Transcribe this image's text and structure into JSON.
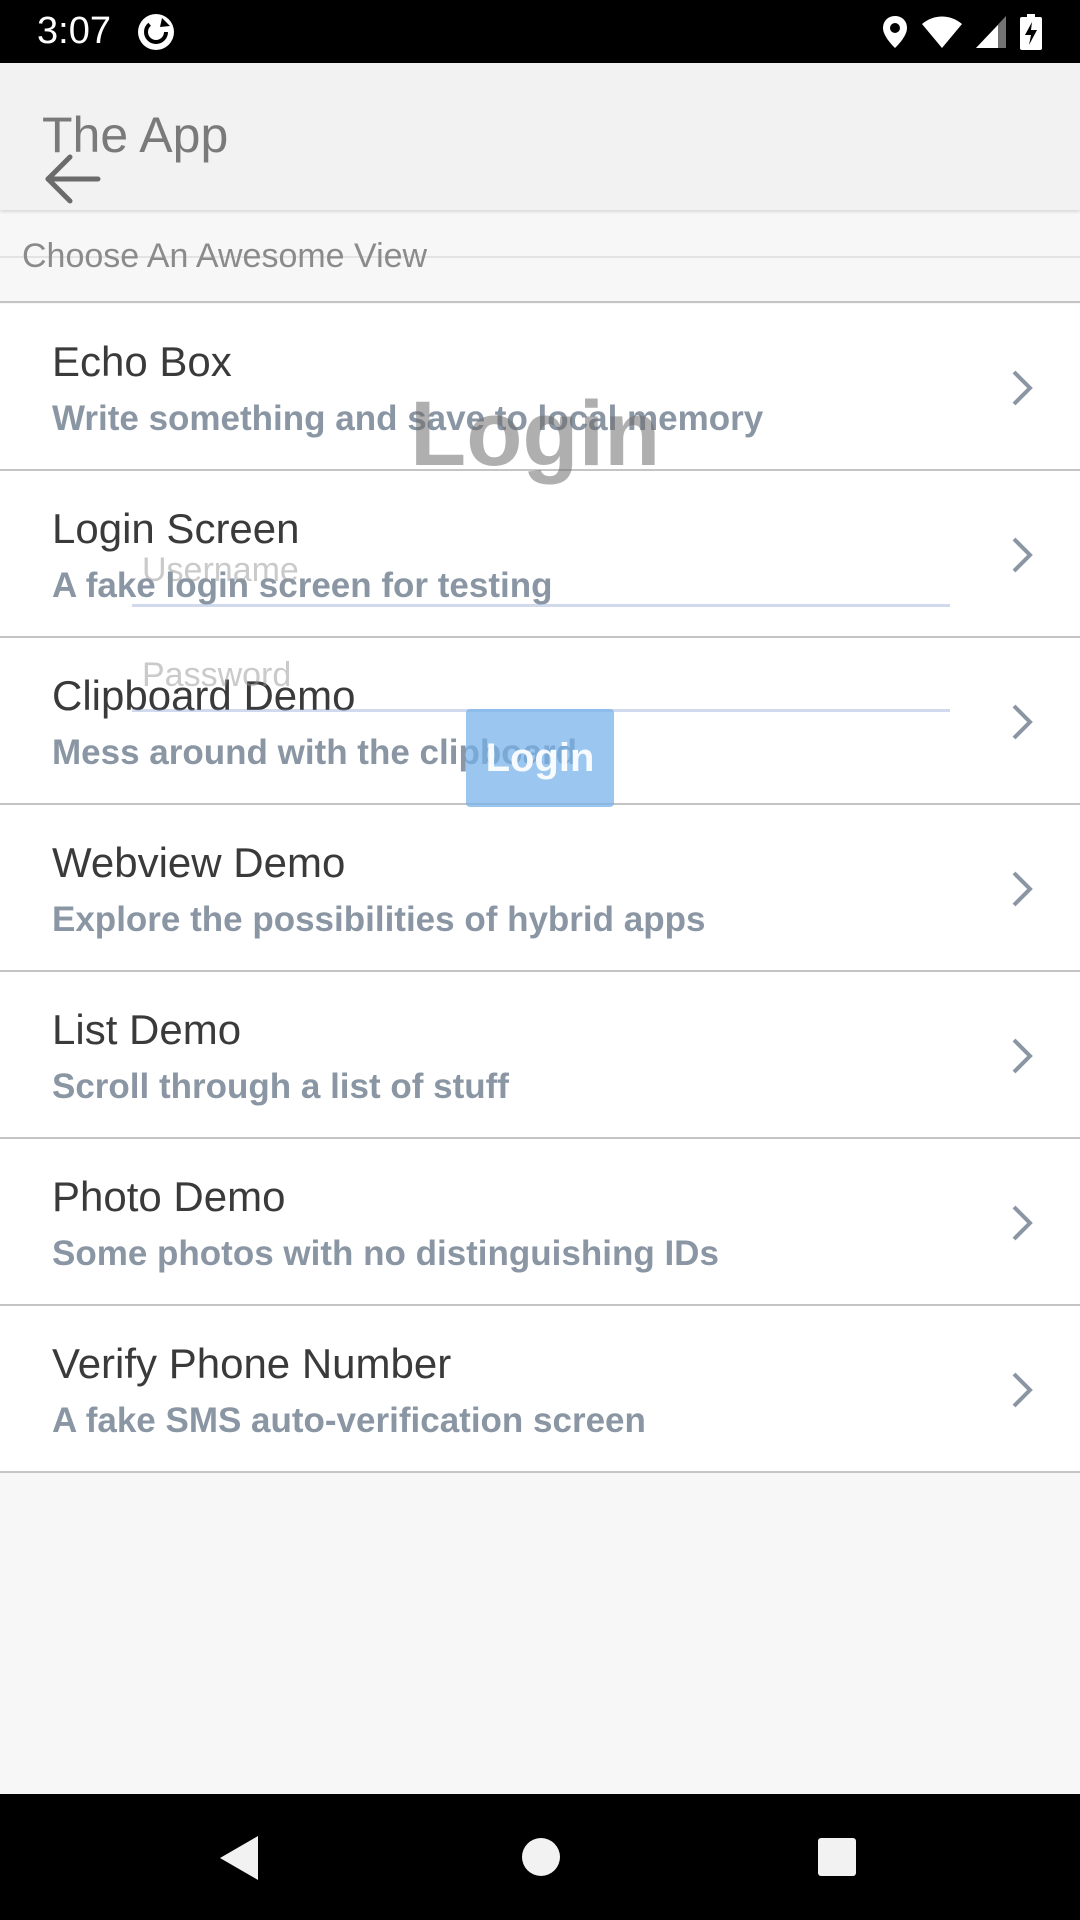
{
  "status_bar": {
    "time": "3:07",
    "icons": [
      "sync-app-icon",
      "location-icon",
      "wifi-icon",
      "signal-icon",
      "battery-charging-icon"
    ]
  },
  "app_bar": {
    "title": "The App",
    "back_icon": "back-arrow-icon"
  },
  "section": {
    "header": "Choose An Awesome View"
  },
  "list": {
    "items": [
      {
        "title": "Echo Box",
        "subtitle": "Write something and save to local memory"
      },
      {
        "title": "Login Screen",
        "subtitle": "A fake login screen for testing"
      },
      {
        "title": "Clipboard Demo",
        "subtitle": "Mess around with the clipboard"
      },
      {
        "title": "Webview Demo",
        "subtitle": "Explore the possibilities of hybrid apps"
      },
      {
        "title": "List Demo",
        "subtitle": "Scroll through a list of stuff"
      },
      {
        "title": "Photo Demo",
        "subtitle": "Some photos with no distinguishing IDs"
      },
      {
        "title": "Verify Phone Number",
        "subtitle": "A fake SMS auto-verification screen"
      }
    ]
  },
  "overlay": {
    "title": "Login",
    "username_placeholder": "Username",
    "password_placeholder": "Password",
    "button_label": "Login"
  },
  "nav_bar": {
    "icons": [
      "nav-back-icon",
      "nav-home-icon",
      "nav-recents-icon"
    ]
  },
  "colors": {
    "status_bar": "#000000",
    "app_bar": "#f2f2f2",
    "title_text": "#3a3a3a",
    "subtitle_text": "#8a96a3",
    "login_button": "#74b0ea"
  }
}
